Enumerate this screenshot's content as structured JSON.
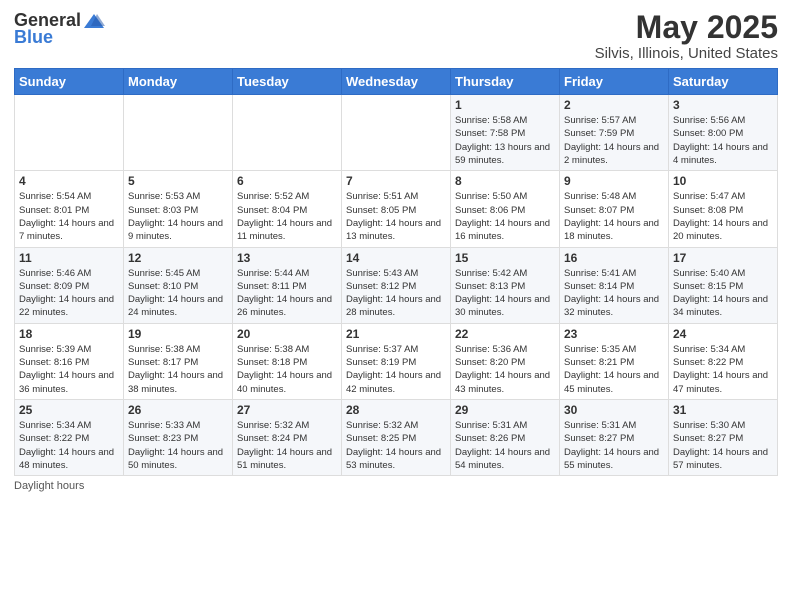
{
  "header": {
    "logo": {
      "general": "General",
      "blue": "Blue"
    },
    "title": "May 2025",
    "subtitle": "Silvis, Illinois, United States"
  },
  "calendar": {
    "days_of_week": [
      "Sunday",
      "Monday",
      "Tuesday",
      "Wednesday",
      "Thursday",
      "Friday",
      "Saturday"
    ],
    "weeks": [
      [
        {
          "day": "",
          "sunrise": "",
          "sunset": "",
          "daylight": ""
        },
        {
          "day": "",
          "sunrise": "",
          "sunset": "",
          "daylight": ""
        },
        {
          "day": "",
          "sunrise": "",
          "sunset": "",
          "daylight": ""
        },
        {
          "day": "",
          "sunrise": "",
          "sunset": "",
          "daylight": ""
        },
        {
          "day": "1",
          "sunrise": "Sunrise: 5:58 AM",
          "sunset": "Sunset: 7:58 PM",
          "daylight": "Daylight: 13 hours and 59 minutes."
        },
        {
          "day": "2",
          "sunrise": "Sunrise: 5:57 AM",
          "sunset": "Sunset: 7:59 PM",
          "daylight": "Daylight: 14 hours and 2 minutes."
        },
        {
          "day": "3",
          "sunrise": "Sunrise: 5:56 AM",
          "sunset": "Sunset: 8:00 PM",
          "daylight": "Daylight: 14 hours and 4 minutes."
        }
      ],
      [
        {
          "day": "4",
          "sunrise": "Sunrise: 5:54 AM",
          "sunset": "Sunset: 8:01 PM",
          "daylight": "Daylight: 14 hours and 7 minutes."
        },
        {
          "day": "5",
          "sunrise": "Sunrise: 5:53 AM",
          "sunset": "Sunset: 8:03 PM",
          "daylight": "Daylight: 14 hours and 9 minutes."
        },
        {
          "day": "6",
          "sunrise": "Sunrise: 5:52 AM",
          "sunset": "Sunset: 8:04 PM",
          "daylight": "Daylight: 14 hours and 11 minutes."
        },
        {
          "day": "7",
          "sunrise": "Sunrise: 5:51 AM",
          "sunset": "Sunset: 8:05 PM",
          "daylight": "Daylight: 14 hours and 13 minutes."
        },
        {
          "day": "8",
          "sunrise": "Sunrise: 5:50 AM",
          "sunset": "Sunset: 8:06 PM",
          "daylight": "Daylight: 14 hours and 16 minutes."
        },
        {
          "day": "9",
          "sunrise": "Sunrise: 5:48 AM",
          "sunset": "Sunset: 8:07 PM",
          "daylight": "Daylight: 14 hours and 18 minutes."
        },
        {
          "day": "10",
          "sunrise": "Sunrise: 5:47 AM",
          "sunset": "Sunset: 8:08 PM",
          "daylight": "Daylight: 14 hours and 20 minutes."
        }
      ],
      [
        {
          "day": "11",
          "sunrise": "Sunrise: 5:46 AM",
          "sunset": "Sunset: 8:09 PM",
          "daylight": "Daylight: 14 hours and 22 minutes."
        },
        {
          "day": "12",
          "sunrise": "Sunrise: 5:45 AM",
          "sunset": "Sunset: 8:10 PM",
          "daylight": "Daylight: 14 hours and 24 minutes."
        },
        {
          "day": "13",
          "sunrise": "Sunrise: 5:44 AM",
          "sunset": "Sunset: 8:11 PM",
          "daylight": "Daylight: 14 hours and 26 minutes."
        },
        {
          "day": "14",
          "sunrise": "Sunrise: 5:43 AM",
          "sunset": "Sunset: 8:12 PM",
          "daylight": "Daylight: 14 hours and 28 minutes."
        },
        {
          "day": "15",
          "sunrise": "Sunrise: 5:42 AM",
          "sunset": "Sunset: 8:13 PM",
          "daylight": "Daylight: 14 hours and 30 minutes."
        },
        {
          "day": "16",
          "sunrise": "Sunrise: 5:41 AM",
          "sunset": "Sunset: 8:14 PM",
          "daylight": "Daylight: 14 hours and 32 minutes."
        },
        {
          "day": "17",
          "sunrise": "Sunrise: 5:40 AM",
          "sunset": "Sunset: 8:15 PM",
          "daylight": "Daylight: 14 hours and 34 minutes."
        }
      ],
      [
        {
          "day": "18",
          "sunrise": "Sunrise: 5:39 AM",
          "sunset": "Sunset: 8:16 PM",
          "daylight": "Daylight: 14 hours and 36 minutes."
        },
        {
          "day": "19",
          "sunrise": "Sunrise: 5:38 AM",
          "sunset": "Sunset: 8:17 PM",
          "daylight": "Daylight: 14 hours and 38 minutes."
        },
        {
          "day": "20",
          "sunrise": "Sunrise: 5:38 AM",
          "sunset": "Sunset: 8:18 PM",
          "daylight": "Daylight: 14 hours and 40 minutes."
        },
        {
          "day": "21",
          "sunrise": "Sunrise: 5:37 AM",
          "sunset": "Sunset: 8:19 PM",
          "daylight": "Daylight: 14 hours and 42 minutes."
        },
        {
          "day": "22",
          "sunrise": "Sunrise: 5:36 AM",
          "sunset": "Sunset: 8:20 PM",
          "daylight": "Daylight: 14 hours and 43 minutes."
        },
        {
          "day": "23",
          "sunrise": "Sunrise: 5:35 AM",
          "sunset": "Sunset: 8:21 PM",
          "daylight": "Daylight: 14 hours and 45 minutes."
        },
        {
          "day": "24",
          "sunrise": "Sunrise: 5:34 AM",
          "sunset": "Sunset: 8:22 PM",
          "daylight": "Daylight: 14 hours and 47 minutes."
        }
      ],
      [
        {
          "day": "25",
          "sunrise": "Sunrise: 5:34 AM",
          "sunset": "Sunset: 8:22 PM",
          "daylight": "Daylight: 14 hours and 48 minutes."
        },
        {
          "day": "26",
          "sunrise": "Sunrise: 5:33 AM",
          "sunset": "Sunset: 8:23 PM",
          "daylight": "Daylight: 14 hours and 50 minutes."
        },
        {
          "day": "27",
          "sunrise": "Sunrise: 5:32 AM",
          "sunset": "Sunset: 8:24 PM",
          "daylight": "Daylight: 14 hours and 51 minutes."
        },
        {
          "day": "28",
          "sunrise": "Sunrise: 5:32 AM",
          "sunset": "Sunset: 8:25 PM",
          "daylight": "Daylight: 14 hours and 53 minutes."
        },
        {
          "day": "29",
          "sunrise": "Sunrise: 5:31 AM",
          "sunset": "Sunset: 8:26 PM",
          "daylight": "Daylight: 14 hours and 54 minutes."
        },
        {
          "day": "30",
          "sunrise": "Sunrise: 5:31 AM",
          "sunset": "Sunset: 8:27 PM",
          "daylight": "Daylight: 14 hours and 55 minutes."
        },
        {
          "day": "31",
          "sunrise": "Sunrise: 5:30 AM",
          "sunset": "Sunset: 8:27 PM",
          "daylight": "Daylight: 14 hours and 57 minutes."
        }
      ]
    ]
  },
  "footer": {
    "note": "Daylight hours"
  }
}
